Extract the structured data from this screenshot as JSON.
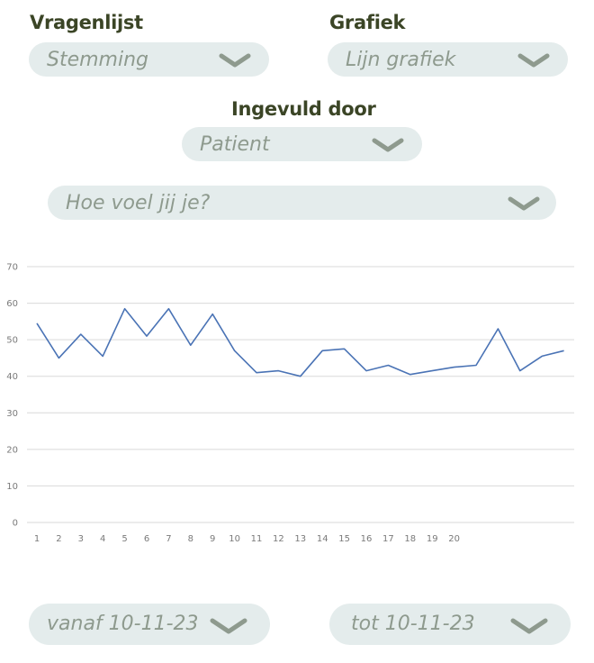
{
  "filters": {
    "questionnaire": {
      "label": "Vragenlijst",
      "value": "Stemming"
    },
    "graph": {
      "label": "Grafiek",
      "value": "Lijn grafiek"
    },
    "filled_by": {
      "label": "Ingevuld door",
      "value": "Patient"
    },
    "question": {
      "value": "Hoe voel jij je?"
    }
  },
  "date_range": {
    "from": "vanaf 10-11-23",
    "to": "tot 10-11-23"
  },
  "icons": {
    "dropdown": "chevron-down-icon"
  },
  "colors": {
    "pill_bg": "#e4ecec",
    "pill_text": "#8e9a8e",
    "label": "#3b4526",
    "line": "#4a73b5",
    "grid": "#d9d9d9"
  },
  "chart_data": {
    "type": "line",
    "x": [
      1,
      2,
      3,
      4,
      5,
      6,
      7,
      8,
      9,
      10,
      11,
      12,
      13,
      14,
      15,
      16,
      17,
      18,
      19,
      20,
      21,
      22,
      23,
      24,
      25
    ],
    "x_tick_labels": [
      "1",
      "2",
      "3",
      "4",
      "5",
      "6",
      "7",
      "8",
      "9",
      "10",
      "11",
      "12",
      "13",
      "14",
      "15",
      "16",
      "17",
      "18",
      "19",
      "20"
    ],
    "series": [
      {
        "values": [
          54.5,
          45,
          51.5,
          45.5,
          58.5,
          51,
          58.5,
          48.5,
          57,
          47,
          41,
          41.5,
          40,
          47,
          47.5,
          41.5,
          43,
          40.5,
          41.5,
          42.5,
          43,
          53,
          41.5,
          45.5,
          47
        ]
      }
    ],
    "ylim": [
      0,
      70
    ],
    "y_ticks": [
      0,
      10,
      20,
      30,
      40,
      50,
      60,
      70
    ],
    "grid": true,
    "legend": "none"
  }
}
